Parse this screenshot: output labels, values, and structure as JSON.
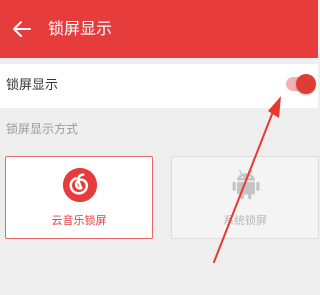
{
  "header": {
    "title": "锁屏显示",
    "back_icon": "arrow-left-icon"
  },
  "lockscreen_toggle": {
    "label": "锁屏显示",
    "enabled": true
  },
  "style_section": {
    "label": "锁屏显示方式",
    "options": [
      {
        "label": "云音乐锁屏",
        "icon": "netease-cloud-music-icon",
        "selected": true
      },
      {
        "label": "系统锁屏",
        "icon": "android-robot-icon",
        "selected": false
      }
    ]
  },
  "colors": {
    "accent": "#e63c3c",
    "switch_track": "#f2b2b2",
    "annotation_arrow": "#e8392f"
  }
}
